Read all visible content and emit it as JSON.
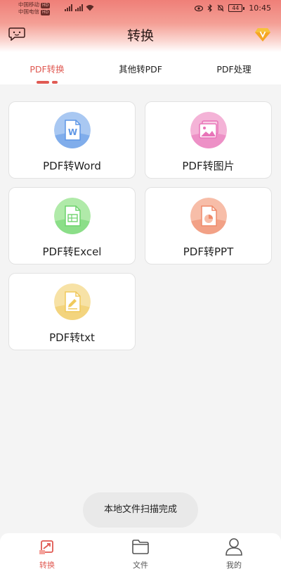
{
  "status_bar": {
    "carrier1": "中国移动",
    "carrier2": "中国电信",
    "hd": "HD",
    "signal_label": "4G",
    "battery": "44",
    "time": "10:45"
  },
  "header": {
    "title": "转换"
  },
  "tabs": [
    {
      "label": "PDF转换",
      "active": true
    },
    {
      "label": "其他转PDF",
      "active": false
    },
    {
      "label": "PDF处理",
      "active": false
    }
  ],
  "cards": [
    {
      "label": "PDF转Word",
      "icon": "word-doc-icon",
      "color": "#5f97e6",
      "light": "#a9c8f2"
    },
    {
      "label": "PDF转图片",
      "icon": "image-icon",
      "color": "#e873b8",
      "light": "#f4b3d7"
    },
    {
      "label": "PDF转Excel",
      "icon": "excel-doc-icon",
      "color": "#6ed36d",
      "light": "#b0eaa9"
    },
    {
      "label": "PDF转PPT",
      "icon": "ppt-doc-icon",
      "color": "#ef8a6a",
      "light": "#f7bda8"
    },
    {
      "label": "PDF转txt",
      "icon": "txt-doc-icon",
      "color": "#f0c95c",
      "light": "#f7e2a6"
    }
  ],
  "toast": {
    "text": "本地文件扫描完成"
  },
  "bottom_nav": [
    {
      "label": "转换",
      "icon": "convert-icon",
      "active": true
    },
    {
      "label": "文件",
      "icon": "folder-icon",
      "active": false
    },
    {
      "label": "我的",
      "icon": "profile-icon",
      "active": false
    }
  ],
  "colors": {
    "accent": "#e05a53",
    "background": "#f4f4f4"
  }
}
